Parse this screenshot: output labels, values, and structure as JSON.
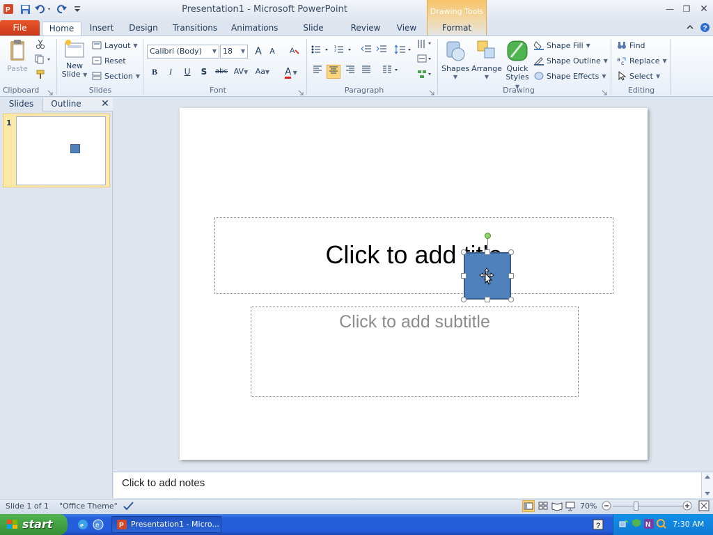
{
  "window": {
    "title": "Presentation1  -  Microsoft PowerPoint",
    "context_tab": "Drawing Tools"
  },
  "tabs": [
    {
      "label": "File"
    },
    {
      "label": "Home"
    },
    {
      "label": "Insert"
    },
    {
      "label": "Design"
    },
    {
      "label": "Transitions"
    },
    {
      "label": "Animations"
    },
    {
      "label": "Slide Show"
    },
    {
      "label": "Review"
    },
    {
      "label": "View"
    },
    {
      "label": "Format"
    }
  ],
  "ribbon": {
    "clipboard": {
      "label": "Clipboard",
      "paste": "Paste"
    },
    "slides": {
      "label": "Slides",
      "new_slide_1": "New",
      "new_slide_2": "Slide",
      "layout": "Layout",
      "reset": "Reset",
      "section": "Section"
    },
    "font": {
      "label": "Font",
      "family": "Calibri (Body)",
      "size": "18",
      "bold": "B",
      "italic": "I",
      "underline": "U",
      "shadow": "S",
      "strike": "abc",
      "spacing": "AV",
      "case": "Aa",
      "color": "A",
      "grow": "A",
      "shrink": "A"
    },
    "paragraph": {
      "label": "Paragraph"
    },
    "drawing": {
      "label": "Drawing",
      "shapes": "Shapes",
      "arrange": "Arrange",
      "quick_styles_1": "Quick",
      "quick_styles_2": "Styles",
      "shape_fill": "Shape Fill",
      "shape_outline": "Shape Outline",
      "shape_effects": "Shape Effects",
      "fill_color": "#4f81bd"
    },
    "editing": {
      "label": "Editing",
      "find": "Find",
      "replace": "Replace",
      "select": "Select"
    }
  },
  "slides_panel": {
    "tab_slides": "Slides",
    "tab_outline": "Outline",
    "slide_number": "1"
  },
  "slide": {
    "title_placeholder": "Click to add title",
    "subtitle_placeholder": "Click to add subtitle",
    "shape_fill": "#4f81bd"
  },
  "notes": {
    "placeholder": "Click to add notes"
  },
  "status": {
    "slide_info": "Slide 1 of 1",
    "theme": "\"Office Theme\"",
    "zoom": "70%"
  },
  "taskbar": {
    "start": "start",
    "task_item": "Presentation1 - Micro...",
    "clock": "7:30 AM"
  }
}
